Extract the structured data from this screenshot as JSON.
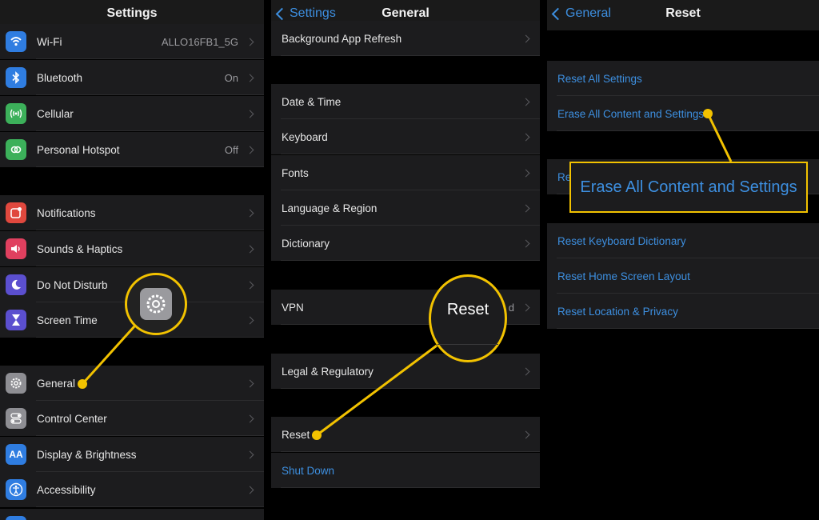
{
  "colors": {
    "accent": "#3d8fe0",
    "highlight": "#f2c200",
    "cell": "#1c1c1e",
    "background": "#000000"
  },
  "settings": {
    "title": "Settings",
    "items": [
      {
        "label": "Wi-Fi",
        "value": "ALLO16FB1_5G",
        "icon": "wifi-icon",
        "color": "#2f7de1"
      },
      {
        "label": "Bluetooth",
        "value": "On",
        "icon": "bluetooth-icon",
        "color": "#2f7de1"
      },
      {
        "label": "Cellular",
        "value": "",
        "icon": "cellular-icon",
        "color": "#3cb05a"
      },
      {
        "label": "Personal Hotspot",
        "value": "Off",
        "icon": "hotspot-icon",
        "color": "#3cb05a"
      },
      {
        "label": "Notifications",
        "value": "",
        "icon": "notifications-icon",
        "color": "#e0483e"
      },
      {
        "label": "Sounds & Haptics",
        "value": "",
        "icon": "sounds-icon",
        "color": "#e0405f"
      },
      {
        "label": "Do Not Disturb",
        "value": "",
        "icon": "moon-icon",
        "color": "#5b4fcf"
      },
      {
        "label": "Screen Time",
        "value": "",
        "icon": "hourglass-icon",
        "color": "#5b4fcf"
      },
      {
        "label": "General",
        "value": "",
        "icon": "gear-icon",
        "color": "#8e8e93"
      },
      {
        "label": "Control Center",
        "value": "",
        "icon": "toggles-icon",
        "color": "#8e8e93"
      },
      {
        "label": "Display & Brightness",
        "value": "",
        "icon": "text-size-icon",
        "color": "#2f7de1"
      },
      {
        "label": "Accessibility",
        "value": "",
        "icon": "accessibility-icon",
        "color": "#2f7de1"
      }
    ]
  },
  "general": {
    "back_label": "Settings",
    "title": "General",
    "items": [
      {
        "label": "Background App Refresh"
      },
      {
        "label": "Date & Time"
      },
      {
        "label": "Keyboard"
      },
      {
        "label": "Fonts"
      },
      {
        "label": "Language & Region"
      },
      {
        "label": "Dictionary"
      },
      {
        "label": "VPN",
        "value": "d"
      },
      {
        "label": "Legal & Regulatory"
      },
      {
        "label": "Reset"
      },
      {
        "label": "Shut Down"
      }
    ],
    "callout": "Reset"
  },
  "reset": {
    "back_label": "General",
    "title": "Reset",
    "items": [
      {
        "label": "Reset All Settings"
      },
      {
        "label": "Erase All Content and Settings"
      },
      {
        "label": "Re"
      },
      {
        "label": "Reset Keyboard Dictionary"
      },
      {
        "label": "Reset Home Screen Layout"
      },
      {
        "label": "Reset Location & Privacy"
      }
    ],
    "callout": "Erase All Content and Settings"
  }
}
